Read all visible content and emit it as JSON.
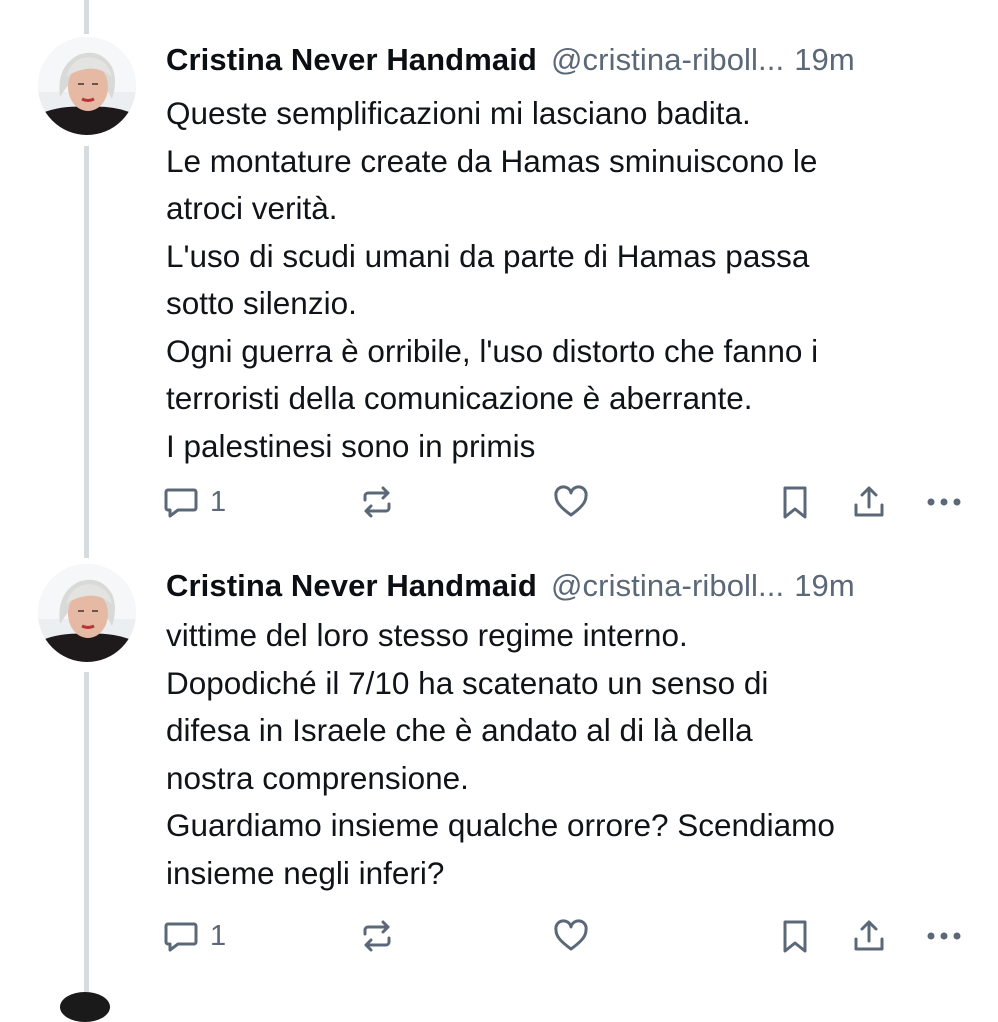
{
  "posts": [
    {
      "author": {
        "name": "Cristina Never Handmaid",
        "handle": "@cristina-riboll...",
        "time": "19m"
      },
      "lines": [
        "Queste semplificazioni mi lasciano badita.",
        "Le montature create da Hamas sminuiscono le",
        "atroci verità.",
        "L'uso di scudi umani da parte di Hamas passa",
        "sotto silenzio.",
        "Ogni guerra è orribile, l'uso distorto che fanno i",
        "terroristi della comunicazione è aberrante.",
        "I palestinesi sono in primis"
      ],
      "reply_count": "1",
      "icons": [
        "reply-icon",
        "repost-icon",
        "like-icon",
        "bookmark-icon",
        "share-icon",
        "more-icon"
      ]
    },
    {
      "author": {
        "name": "Cristina Never Handmaid",
        "handle": "@cristina-riboll...",
        "time": "19m"
      },
      "lines": [
        "vittime del loro stesso regime interno.",
        "Dopodiché il 7/10 ha scatenato un senso di",
        "difesa in Israele che è andato al di là della",
        "nostra comprensione.",
        "Guardiamo insieme qualche orrore? Scendiamo",
        "insieme negli inferi?"
      ],
      "reply_count": "1",
      "icons": [
        "reply-icon",
        "repost-icon",
        "like-icon",
        "bookmark-icon",
        "share-icon",
        "more-icon"
      ]
    }
  ],
  "colors": {
    "text": "#0f1419",
    "muted": "#5b6877",
    "thread_line": "#d6dbe0",
    "background": "#ffffff"
  }
}
